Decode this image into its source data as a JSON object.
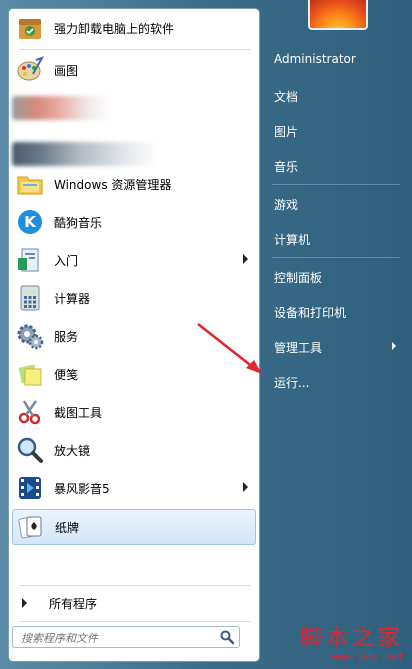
{
  "programs": [
    {
      "label": "强力卸载电脑上的软件",
      "icon": "uninstall-box-icon"
    },
    {
      "label": "画图",
      "icon": "paint-palette-icon"
    },
    {
      "label": "",
      "icon": "blurred-app-icon"
    },
    {
      "label": "",
      "icon": "blurred-app-icon"
    },
    {
      "label": "Windows 资源管理器",
      "icon": "folder-explorer-icon"
    },
    {
      "label": "酷狗音乐",
      "icon": "kugou-k-icon"
    },
    {
      "label": "入门",
      "icon": "getting-started-icon"
    },
    {
      "label": "计算器",
      "icon": "calculator-icon"
    },
    {
      "label": "服务",
      "icon": "services-gear-icon"
    },
    {
      "label": "便笺",
      "icon": "sticky-notes-icon"
    },
    {
      "label": "截图工具",
      "icon": "snipping-tool-icon"
    },
    {
      "label": "放大镜",
      "icon": "magnifier-icon"
    },
    {
      "label": "暴风影音5",
      "icon": "baofeng-film-icon"
    },
    {
      "label": "纸牌",
      "icon": "solitaire-card-icon"
    }
  ],
  "all_programs": "所有程序",
  "search": {
    "placeholder": "搜索程序和文件"
  },
  "right_links": [
    {
      "label": "Administrator"
    },
    {
      "label": "文档"
    },
    {
      "label": "图片"
    },
    {
      "label": "音乐"
    },
    {
      "label": "游戏"
    },
    {
      "label": "计算机"
    },
    {
      "label": "控制面板"
    },
    {
      "label": "设备和打印机"
    },
    {
      "label": "管理工具"
    },
    {
      "label": "运行..."
    }
  ],
  "watermark": {
    "title": "脚本之家",
    "url": "www.jb51.net"
  },
  "colors": {
    "accent_red": "#e0262e",
    "selection": "#d4e6f8"
  }
}
